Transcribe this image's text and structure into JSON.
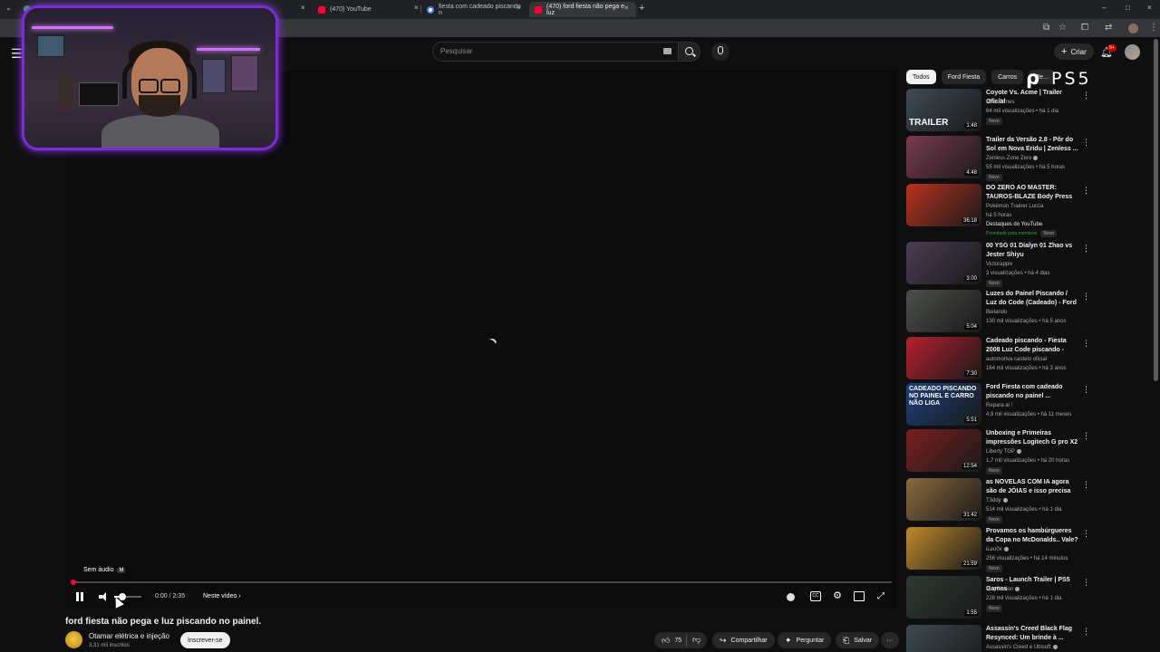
{
  "browser": {
    "tabs": [
      {
        "title": "(470) YouTube",
        "icon": "youtube-icon"
      },
      {
        "title": "fiesta com cadeado piscando n",
        "icon": "google-icon"
      },
      {
        "title": "(470) ford fiesta não pega e luz",
        "icon": "youtube-icon",
        "active": true
      }
    ],
    "new_tab_symbol": "+",
    "close_symbol": "×",
    "window_controls": [
      "–",
      "□",
      "×"
    ]
  },
  "masthead": {
    "search_placeholder": "Pesquisar",
    "create_label": "Criar",
    "notification_count": "9+"
  },
  "player": {
    "mute_tooltip": "Sem áudio",
    "mute_key": "M",
    "time": "0:00 / 2:35",
    "chapter_label": "Neste vídeo",
    "progress_fraction": 0.003,
    "volume_fraction": 0.3
  },
  "video": {
    "title": "ford fiesta não pega e luz piscando no painel.",
    "channel": "Otamar elétrica e injeção",
    "subscribers": "3,31 mil inscritos",
    "subscribe_label": "Inscrever-se",
    "likes": "75",
    "share_label": "Compartilhar",
    "ask_label": "Perguntar",
    "save_label": "Salvar"
  },
  "overlay": {
    "ps5_text": "PS5"
  },
  "sidebar": {
    "chips": [
      "Todos",
      "Ford Fiesta",
      "Carros",
      "Re..."
    ],
    "new_badge": "Novo",
    "items": [
      {
        "title": "Coyote Vs. Acme | Trailer Oficial",
        "channel": "ParisFilmes",
        "meta": "64 mil visualizações • há 1 dia",
        "duration": "1:48",
        "thumb_text": "TRAILER",
        "thumb_color": "#3d4b56",
        "badge": true
      },
      {
        "title": "Trailer da Versão 2.8 - Pôr do Sol em Nova Eridu | Zenless ...",
        "channel": "Zenless Zone Zero",
        "meta": "55 mil visualizações • há 5 horas",
        "duration": "4:48",
        "thumb_text": "",
        "thumb_color": "#7a3a4e",
        "badge": true,
        "verified": true
      },
      {
        "title": "DO ZERO AO MASTER: TAUROS-BLAZE Body Press ...",
        "channel": "Pokémon Trainer Lucca",
        "meta": "há 5 horas",
        "extra": "Destaques do YouTube",
        "member": "Prioridade para membros",
        "duration": "36:18",
        "thumb_text": "",
        "thumb_color": "#b8321f",
        "badge": false
      },
      {
        "title": "00 YSG 01 Dialyn 01 Zhao vs Jester Shiyu",
        "channel": "Victorappiv",
        "meta": "3 visualizações • há 4 dias",
        "duration": "3:00",
        "thumb_text": "",
        "thumb_color": "#4a3d52",
        "badge": true
      },
      {
        "title": "Luzes do Painel Piscando / Luz do Code (Cadeado) - Ford ...",
        "channel": "Bielando",
        "meta": "130 mil visualizações • há 5 anos",
        "duration": "5:04",
        "thumb_text": "",
        "thumb_color": "#4b4f4a",
        "badge": false
      },
      {
        "title": "Cadeado piscando - Fiesta 2008 Luz Code piscando - veículo ...",
        "channel": "automotiva castelo oficial",
        "meta": "164 mil visualizações • há 3 anos",
        "duration": "7:30",
        "thumb_text": "",
        "thumb_color": "#b3202e",
        "badge": false
      },
      {
        "title": "Ford Fiesta com cadeado piscando no painel ...",
        "channel": "Repara aí !",
        "meta": "4,9 mil visualizações • há 11 meses",
        "duration": "5:51",
        "thumb_text": "CADEADO PISCANDO NO PAINEL E CARRO NÃO LIGA",
        "thumb_color": "#1d3f7a",
        "badge": false
      },
      {
        "title": "Unboxing e Primeiras impressões Logitech G pro X2 ...",
        "channel": "Liberty TGP",
        "meta": "1,7 mil visualizações • há 20 horas",
        "duration": "12:54",
        "thumb_text": "",
        "thumb_color": "#7a1f1f",
        "badge": true,
        "verified": true
      },
      {
        "title": "as NOVELAS COM IA agora são de JÓIAS e isso precisa acabar",
        "channel": "T3ddy",
        "meta": "514 mil visualizações • há 1 dia",
        "duration": "31:42",
        "thumb_text": "",
        "thumb_color": "#8a6a3e",
        "badge": true,
        "verified": true
      },
      {
        "title": "Provamos os hambúrgueres da Copa no McDonalds.. Vale?",
        "channel": "iLeo0x",
        "meta": "256 visualizações • há 14 minutos",
        "duration": "21:59",
        "thumb_text": "",
        "thumb_color": "#c08a2a",
        "badge": true,
        "verified": true
      },
      {
        "title": "Saros - Launch Trailer | PS5 Games",
        "channel": "PlayStation",
        "meta": "228 mil visualizações • há 1 dia",
        "duration": "1:55",
        "thumb_text": "",
        "thumb_color": "#2d3a32",
        "badge": true,
        "verified": true
      },
      {
        "title": "Assassin's Creed Black Flag Resynced: Um brinde à ...",
        "channel": "Assassin's Creed e Ubisoft",
        "meta": "",
        "duration": "",
        "thumb_text": "",
        "thumb_color": "#3c4a52",
        "badge": false,
        "verified": true
      }
    ]
  },
  "colors": {
    "accent_red": "#ff0033",
    "webcam_border": "#7a2cd6",
    "background": "#0f0f0f"
  }
}
